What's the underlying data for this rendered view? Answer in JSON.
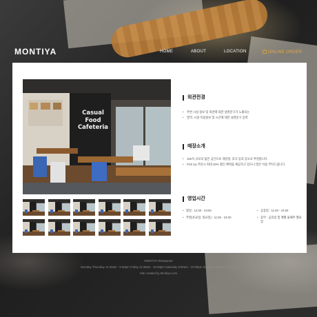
{
  "brand": {
    "logo": "MONTIYA"
  },
  "nav": {
    "items": [
      "HOME",
      "ABOUT",
      "LOCATION"
    ],
    "order_label": "ONLINE ORDER",
    "order_icon": "cart-icon",
    "order_color": "#f0a830"
  },
  "photo": {
    "sign_lines": [
      "Casual",
      "Food",
      "Cafeteria"
    ]
  },
  "thumbnail_count": 12,
  "sections": {
    "exterior": {
      "title": "외관전경",
      "bullets": [
        "주변 시설 정보 및 외관에 대한 설명문구가 노출되는",
        "영역.  시설 이용정보 및 시간에 대한 설명문구 입력"
      ]
    },
    "store": {
      "title": "매장소개",
      "bullets": [
        "150석 규모의 넓은 공간으로 개방형, 휴식 등의 장소로 추천합니다.",
        "Pick Up 주문시 최대 30% 할인 혜택을 제공하고 있으니 많은 이용 부탁드립니다."
      ]
    },
    "hours": {
      "title": "영업시간",
      "rows": [
        [
          "평일 : 12:00 - 23:00",
          "공휴일 : 11:00 - 24:00"
        ],
        [
          "주말(토요일, 일요일) : 11:00 - 24:00",
          "휴무 : 공휴일 및 매월 둘째주 월요일"
        ]
      ]
    }
  },
  "footer": {
    "lines": [
      "MONTIYA Restaurant",
      "Monday-Thursday 11:30am - 9:30pm     Friday 11:30am - 10:30pm     Saturday 9:00am - 10:30pm     Sunday 9:00am - 9:30pm",
      "Site created by Montiya.com"
    ]
  }
}
